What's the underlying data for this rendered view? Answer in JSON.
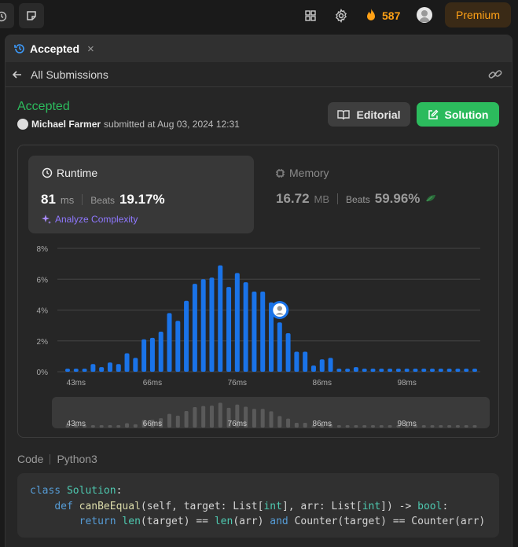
{
  "topbar": {
    "streak_count": "587",
    "premium_label": "Premium"
  },
  "tab": {
    "label": "Accepted",
    "close": "×"
  },
  "subbar": {
    "back_label": "All Submissions"
  },
  "submission": {
    "status": "Accepted",
    "user": "Michael Farmer",
    "submitted_text": "submitted at Aug 03, 2024 12:31"
  },
  "buttons": {
    "editorial": "Editorial",
    "solution": "Solution"
  },
  "runtime": {
    "title": "Runtime",
    "value": "81",
    "unit": "ms",
    "beats_label": "Beats",
    "beats_value": "19.17%",
    "analyze": "Analyze Complexity"
  },
  "memory": {
    "title": "Memory",
    "value": "16.72",
    "unit": "MB",
    "beats_label": "Beats",
    "beats_value": "59.96%"
  },
  "colors": {
    "accent_green": "#2cbb5d",
    "bar_blue": "#1a73e8",
    "premium_orange": "#ffa116",
    "analyze_purple": "#8f78ff"
  },
  "chart_data": {
    "type": "bar",
    "title": "",
    "xlabel": "",
    "ylabel": "",
    "ylim": [
      0,
      8
    ],
    "yticks": [
      "0%",
      "2%",
      "4%",
      "6%",
      "8%"
    ],
    "xtick_labels": [
      "43ms",
      "66ms",
      "76ms",
      "86ms",
      "98ms"
    ],
    "xtick_bins": [
      1,
      10,
      20,
      30,
      40
    ],
    "values": [
      0.2,
      0.2,
      0.2,
      0.5,
      0.3,
      0.6,
      0.5,
      1.2,
      0.9,
      2.1,
      2.2,
      2.6,
      3.8,
      3.3,
      4.6,
      5.7,
      6.0,
      6.1,
      6.9,
      5.5,
      6.4,
      5.8,
      5.2,
      5.2,
      4.5,
      3.2,
      2.5,
      1.3,
      1.3,
      0.4,
      0.8,
      0.9,
      0.2,
      0.2,
      0.3,
      0.2,
      0.2,
      0.2,
      0.2,
      0.2,
      0.2,
      0.2,
      0.2,
      0.2,
      0.2,
      0.2,
      0.2,
      0.2,
      0.2
    ],
    "highlight_bin": 25,
    "highlight_value": 4.0,
    "grid": true,
    "overview": {
      "xtick_labels": [
        "43ms",
        "66ms",
        "76ms",
        "86ms",
        "98ms"
      ]
    }
  },
  "code": {
    "label": "Code",
    "language": "Python3",
    "lines": [
      [
        "class",
        " ",
        "Solution",
        ":"
      ],
      [
        "    ",
        "def",
        " ",
        "canBeEqual",
        "(self, target: List[",
        "int",
        "], arr: List[",
        "int",
        "]) -> ",
        "bool",
        ":"
      ],
      [
        "        ",
        "return",
        " ",
        "len",
        "(target) == ",
        "len",
        "(arr) ",
        "and",
        " Counter(target) == Counter(arr)"
      ]
    ]
  }
}
